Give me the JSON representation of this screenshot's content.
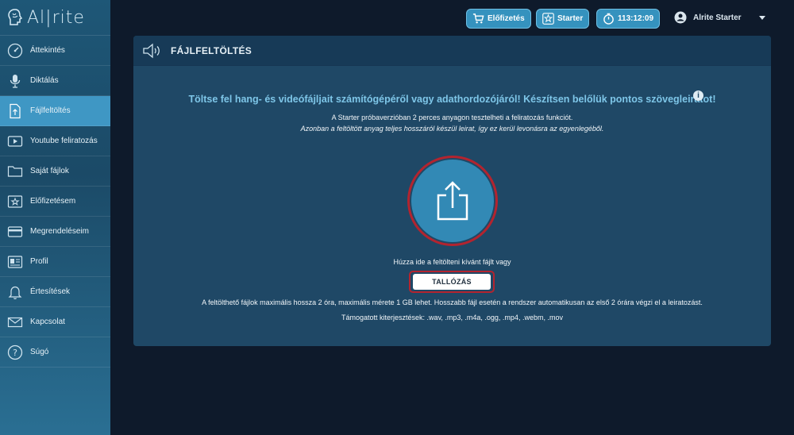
{
  "app": {
    "logo_text": "Al|rite"
  },
  "sidebar": {
    "items": [
      {
        "label": "Áttekintés",
        "icon": "dashboard-gauge-icon"
      },
      {
        "label": "Diktálás",
        "icon": "microphone-icon"
      },
      {
        "label": "Fájlfeltöltés",
        "icon": "file-upload-icon",
        "active": true
      },
      {
        "label": "Youtube feliratozás",
        "icon": "youtube-play-icon"
      },
      {
        "label": "Saját fájlok",
        "icon": "folder-icon"
      },
      {
        "label": "Előfizetésem",
        "icon": "star-subscription-icon"
      },
      {
        "label": "Megrendeléseim",
        "icon": "credit-card-icon"
      },
      {
        "label": "Profil",
        "icon": "profile-card-icon"
      },
      {
        "label": "Értesítések",
        "icon": "bell-icon"
      },
      {
        "label": "Kapcsolat",
        "icon": "envelope-icon"
      },
      {
        "label": "Súgó",
        "icon": "help-question-icon"
      }
    ]
  },
  "topbar": {
    "subscribe_label": "Előfizetés",
    "plan_label": "Starter",
    "timer_label": "113:12:09",
    "user_name": "Alrite Starter"
  },
  "panel": {
    "title": "FÁJLFELTÖLTÉS",
    "headline": "Töltse fel hang- és videófájljait számítógépéről vagy adathordozójáról! Készítsen belőlük pontos szövegleiratot!",
    "info_icon_glyph": "i",
    "line1": "A Starter próbaverzióban 2 perces anyagon tesztelheti a feliratozás funkciót.",
    "line2": "Azonban a feltöltött anyag teljes hosszáról készül leirat, így ez kerül levonásra az egyenlegéből.",
    "drag_text": "Húzza ide a feltölteni kívánt fájlt vagy",
    "browse_label": "TALLÓZÁS",
    "limits_text": "A feltölthető fájlok maximális hossza 2 óra, maximális mérete 1 GB lehet. Hosszabb fájl esetén a rendszer automatikusan az első 2 órára végzi el a leiratozást.",
    "formats_text": "Támogatott kiterjesztések: .wav, .mp3, .m4a, .ogg, .mp4, .webm, .mov"
  },
  "colors": {
    "sidebar_active": "#3f97c4",
    "panel_bg": "#1f4866",
    "accent": "#3592be",
    "headline": "#7ec6e8",
    "highlight_ring": "#b3242f"
  }
}
